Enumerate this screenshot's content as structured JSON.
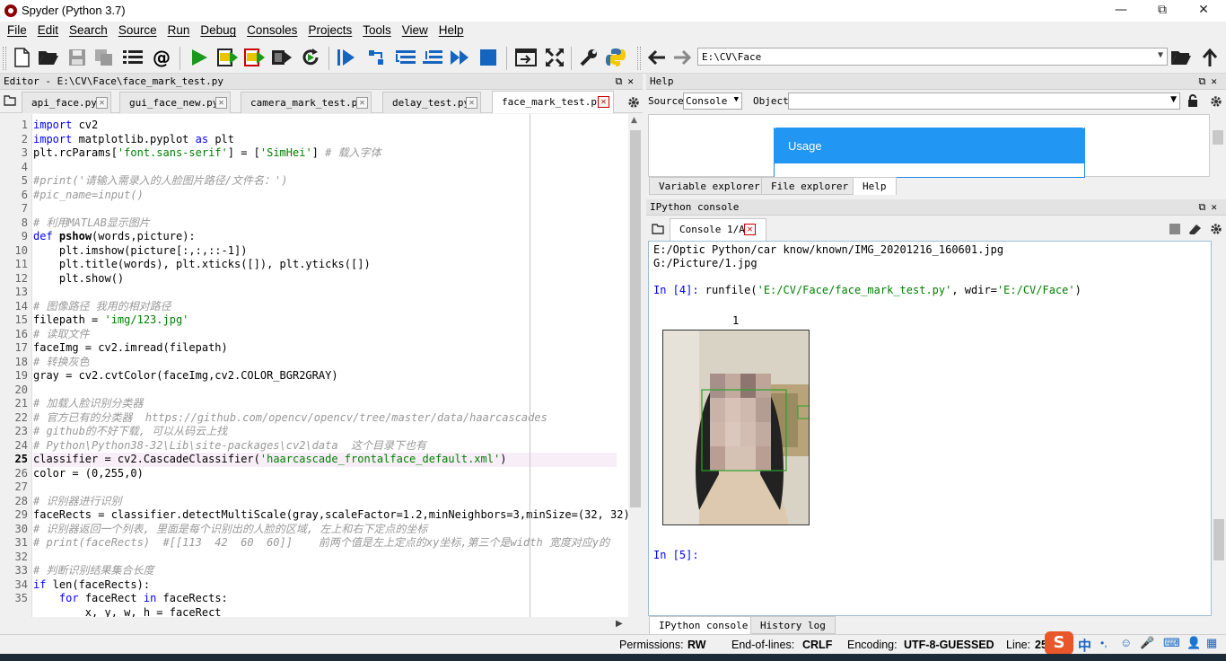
{
  "window": {
    "title": "Spyder (Python 3.7)",
    "minimize": "—",
    "maximize": "⧉",
    "close": "✕"
  },
  "menu": [
    "File",
    "Edit",
    "Search",
    "Source",
    "Run",
    "Debug",
    "Consoles",
    "Projects",
    "Tools",
    "View",
    "Help"
  ],
  "toolbar": {
    "icons": [
      "new-file-icon",
      "open-file-icon",
      "save-icon",
      "save-all-icon",
      "list-icon",
      "at-icon",
      "run-icon",
      "run-cell-icon",
      "run-cell-advance-icon",
      "run-selection-icon",
      "rerun-icon",
      "debug-icon",
      "step-icon",
      "step-into-icon",
      "step-return-icon",
      "continue-icon",
      "stop-icon",
      "maximize-pane-icon",
      "fullscreen-icon",
      "wrench-icon",
      "python-path-icon",
      "back-arrow-icon",
      "forward-arrow-icon",
      "browse-folder-icon",
      "up-arrow-icon"
    ],
    "working_dir": "E:\\CV\\Face"
  },
  "editor": {
    "title": "Editor - E:\\CV\\Face\\face_mark_test.py",
    "tabs": [
      "api_face.py",
      "gui_face_new.py",
      "camera_mark_test.py",
      "delay_test.py",
      "face_mark_test.py"
    ],
    "active_tab": 4,
    "line_numbers": [
      "1",
      "2",
      "3",
      "4",
      "5",
      "6",
      "7",
      "8",
      "9",
      "10",
      "11",
      "12",
      "13",
      "14",
      "15",
      "16",
      "17",
      "18",
      "19",
      "20",
      "21",
      "22",
      "23",
      "24",
      "25",
      "26",
      "27",
      "28",
      "29",
      "30",
      "31",
      "32",
      "33",
      "34",
      "35"
    ],
    "current_line": 25
  },
  "help": {
    "title": "Help",
    "source_label": "Source",
    "source_value": "Console",
    "object_label": "Object",
    "object_value": "",
    "usage_title": "Usage",
    "bottom_tabs": [
      "Variable explorer",
      "File explorer",
      "Help"
    ]
  },
  "console": {
    "title": "IPython console",
    "tab": "Console 1/A",
    "lines": {
      "l0": "E:/Optic Python/car know/known/IMG_20201216_160601.jpg",
      "l1": "G:/Picture/1.jpg",
      "prompt4": "In [4]:",
      "cmd4a": " runfile(",
      "cmd4b": "'E:/CV/Face/face_mark_test.py'",
      "cmd4c": ", wdir=",
      "cmd4d": "'E:/CV/Face'",
      "cmd4e": ")",
      "figure_title": "1",
      "prompt5": "In [5]:"
    },
    "bottom_tabs": [
      "IPython console",
      "History log"
    ]
  },
  "status": {
    "permissions_label": "Permissions:",
    "permissions": "RW",
    "eol_label": "End-of-lines:",
    "eol": "CRLF",
    "encoding_label": "Encoding:",
    "encoding": "UTF-8-GUESSED",
    "line_label": "Line:",
    "line": "25",
    "ime": "中"
  },
  "colors": {
    "keyword": "#0000ff",
    "string": "#008000",
    "comment": "#999999",
    "accent": "#2196f3",
    "run_green": "#1a9a1a",
    "stop_blue": "#1565c0"
  }
}
